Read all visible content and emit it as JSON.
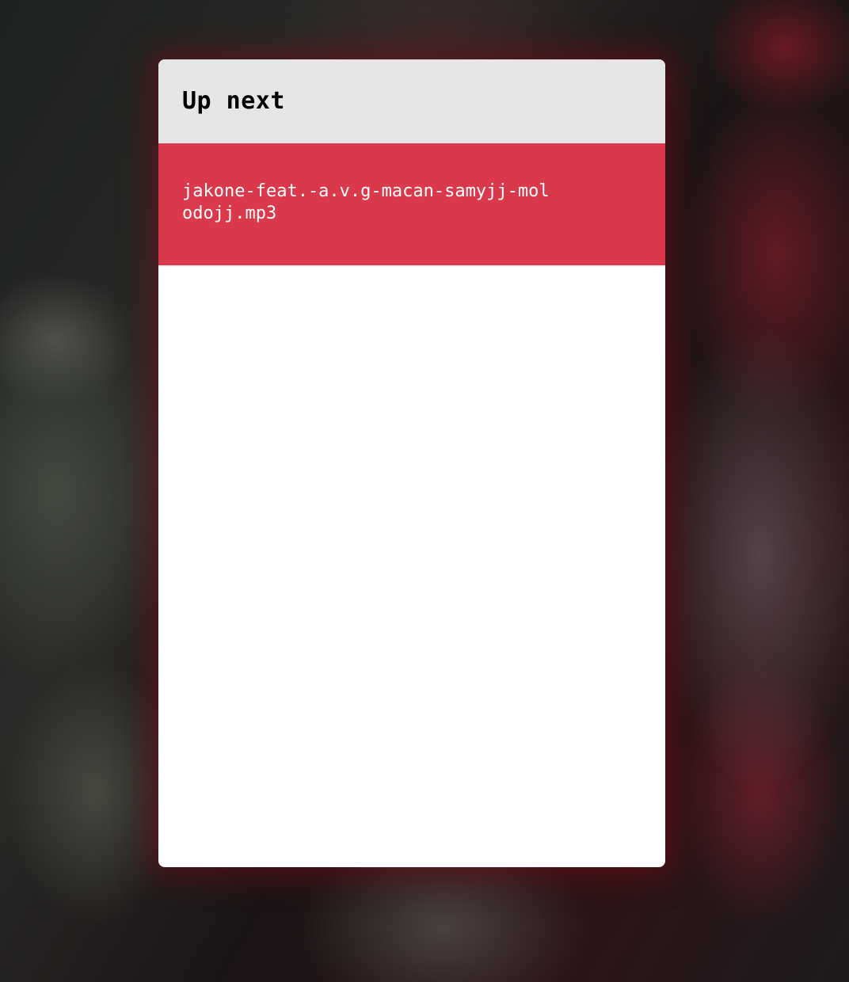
{
  "queue": {
    "title": "Up next",
    "items": [
      {
        "label": "jakone-feat.-a.v.g-macan-samyjj-molodojj.mp3",
        "active": true
      }
    ]
  },
  "colors": {
    "header_bg": "#e6e6e6",
    "active_item_bg": "#d9394b",
    "panel_bg": "#ffffff"
  }
}
